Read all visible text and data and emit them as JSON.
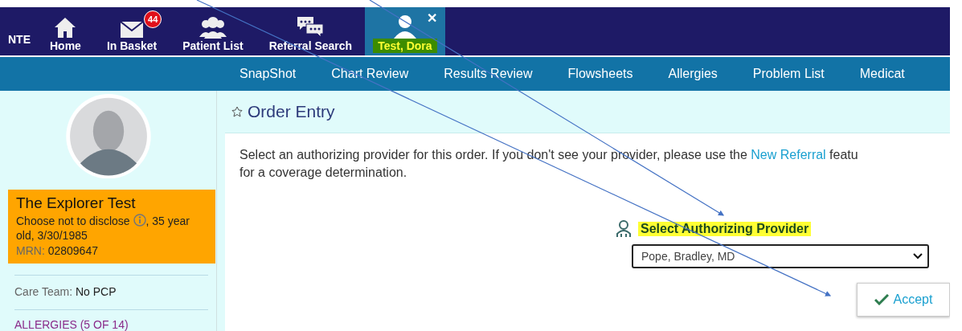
{
  "header": {
    "logo_fragment": "NTE",
    "nav": [
      {
        "kind": "home",
        "label": "Home",
        "selected": false
      },
      {
        "kind": "mail",
        "label": "In Basket",
        "badge": "44",
        "selected": false
      },
      {
        "kind": "people",
        "label": "Patient List",
        "selected": false
      },
      {
        "kind": "chat",
        "label": "Referral Search",
        "selected": false
      },
      {
        "kind": "patient",
        "label": "Test, Dora",
        "selected": true,
        "close": "✕"
      }
    ]
  },
  "activity_tabs": [
    "SnapShot",
    "Chart Review",
    "Results Review",
    "Flowsheets",
    "Allergies",
    "Problem List",
    "Medicat"
  ],
  "patient": {
    "name": "The Explorer Test",
    "sex": "Choose not to disclose",
    "details": ", 35 year old, 3/30/1985",
    "mrn_label": "MRN:",
    "mrn": "02809647",
    "care_team_label": "Care Team:",
    "care_team": "No PCP",
    "allergies": "ALLERGIES (5 OF 14)"
  },
  "order_entry": {
    "title": "Order Entry",
    "instruction_before": "Select an authorizing provider for this order. If you don't see your provider, please use the ",
    "link": "New Referral",
    "instruction_after": " featu",
    "instruction_line2": "for a coverage determination.",
    "provider_label": "Select Authorizing Provider",
    "provider": "Pope, Bradley, MD",
    "accept": "Accept"
  }
}
